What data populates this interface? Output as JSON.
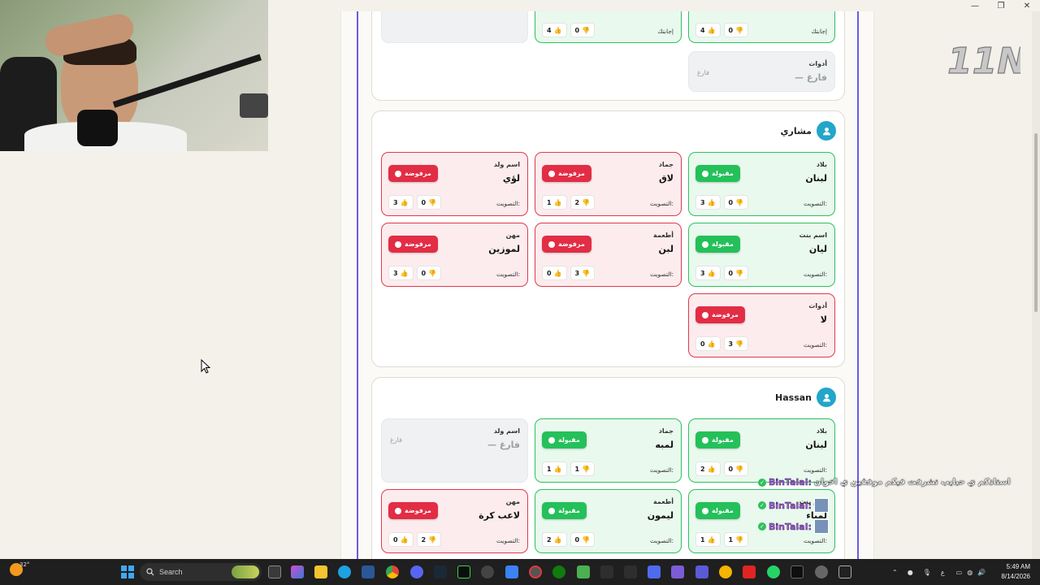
{
  "window": {
    "minimize_glyph": "—",
    "maximize_glyph": "❐",
    "close_glyph": "✕"
  },
  "labels": {
    "vote_label": "التصويت:",
    "accepted": "مقبولة",
    "rejected": "مرفوضة",
    "empty_tag": "فارغ",
    "your_answer": "إجابتك"
  },
  "top_partial": {
    "cards": [
      {
        "label": "إجابتك",
        "up": "4",
        "down": "0"
      },
      {
        "label": "إجابتك",
        "up": "4",
        "down": "0"
      }
    ],
    "tools_card": {
      "category": "أدوات",
      "answer": "— فارغ",
      "tag": "فارغ"
    }
  },
  "players": [
    {
      "name": "مشاري",
      "cards": [
        {
          "category": "بلاد",
          "answer": "لبنان",
          "status": "مقبولة",
          "up": "3",
          "down": "0"
        },
        {
          "category": "جماد",
          "answer": "لاق",
          "status": "مرفوضة",
          "up": "1",
          "down": "2"
        },
        {
          "category": "اسم ولد",
          "answer": "لؤي",
          "status": "مرفوضة",
          "up": "3",
          "down": "0"
        },
        {
          "category": "اسم بنت",
          "answer": "ليان",
          "status": "مقبولة",
          "up": "3",
          "down": "0"
        },
        {
          "category": "أطعمة",
          "answer": "لبن",
          "status": "مرفوضة",
          "up": "0",
          "down": "3"
        },
        {
          "category": "مهن",
          "answer": "لموزين",
          "status": "مرفوضة",
          "up": "3",
          "down": "0"
        },
        {
          "category": "أدوات",
          "answer": "لا",
          "status": "مرفوضة",
          "up": "0",
          "down": "3"
        }
      ]
    },
    {
      "name": "Hassan",
      "cards": [
        {
          "category": "بلاد",
          "answer": "لبنان",
          "status": "مقبولة",
          "up": "2",
          "down": "0"
        },
        {
          "category": "جماد",
          "answer": "لمبه",
          "status": "مقبولة",
          "up": "1",
          "down": "1"
        },
        {
          "category": "اسم ولد",
          "answer": "— فارغ",
          "tag": "فارغ"
        },
        {
          "category": "اسم بنت",
          "answer": "لمياء",
          "status": "مقبولة",
          "up": "1",
          "down": "1"
        },
        {
          "category": "أطعمة",
          "answer": "ليمون",
          "status": "مقبولة",
          "up": "2",
          "down": "0"
        },
        {
          "category": "مهن",
          "answer": "لاعب كرة",
          "status": "مرفوضة",
          "up": "0",
          "down": "2"
        }
      ]
    }
  ],
  "chat": [
    {
      "user": "BinTalal:",
      "message": "استاذكم ي حبايب تشرفت فيكم موفقين ي اخوان"
    },
    {
      "user": "BinTalal:",
      "message": ""
    },
    {
      "user": "BinTalal:",
      "message": ""
    }
  ],
  "logo_text": "11N",
  "taskbar": {
    "weather_temp": "32°",
    "search_placeholder": "Search",
    "lang": "ع",
    "time": "5:49 AM",
    "date": "8/14/2026"
  },
  "colors": {
    "accent_purple": "#6b5be2",
    "accepted_green": "#24c05a",
    "rejected_red": "#e22d45",
    "avatar_teal": "#22a6c9"
  }
}
